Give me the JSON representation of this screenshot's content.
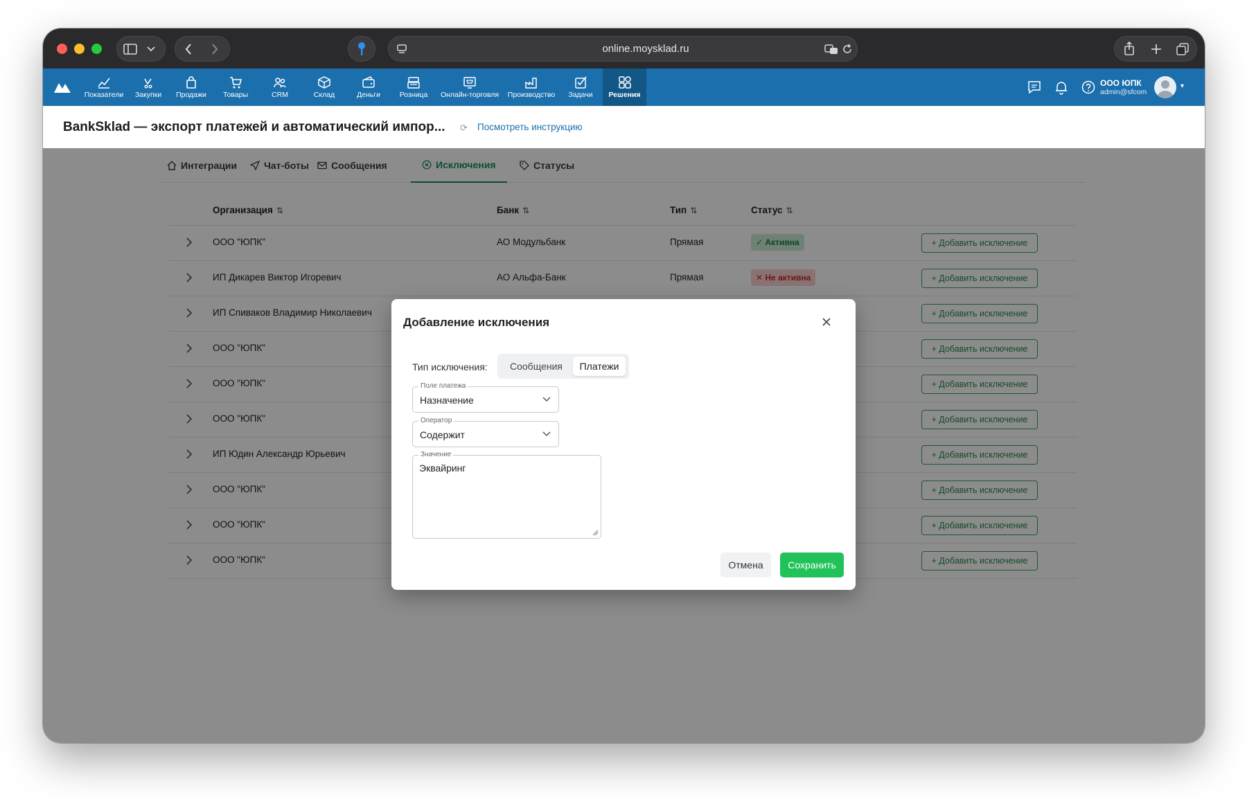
{
  "browser": {
    "url": "online.moysklad.ru"
  },
  "nav": {
    "items": [
      {
        "label": "Показатели",
        "icon": "chart-line-icon"
      },
      {
        "label": "Закупки",
        "icon": "bag-icon"
      },
      {
        "label": "Продажи",
        "icon": "shopping-bag-icon"
      },
      {
        "label": "Товары",
        "icon": "cart-icon"
      },
      {
        "label": "CRM",
        "icon": "people-icon"
      },
      {
        "label": "Склад",
        "icon": "box-icon"
      },
      {
        "label": "Деньги",
        "icon": "wallet-icon"
      },
      {
        "label": "Розница",
        "icon": "cash-register-icon"
      },
      {
        "label": "Онлайн-торговля",
        "icon": "online-store-icon"
      },
      {
        "label": "Производство",
        "icon": "factory-icon"
      },
      {
        "label": "Задачи",
        "icon": "checkbox-icon"
      },
      {
        "label": "Решения",
        "icon": "grid-icon"
      }
    ],
    "active": "Решения",
    "org_name": "ООО ЮПК",
    "org_email": "admin@sfcom"
  },
  "page": {
    "title": "BankSklad — экспорт платежей и автоматический импор...",
    "instruction_link": "Посмотреть инструкцию"
  },
  "tabs": [
    {
      "label": "Интеграции",
      "icon": "home-icon"
    },
    {
      "label": "Чат-боты",
      "icon": "send-icon"
    },
    {
      "label": "Сообщения",
      "icon": "envelope-icon"
    },
    {
      "label": "Исключения",
      "icon": "circle-x-icon"
    },
    {
      "label": "Статусы",
      "icon": "tag-icon"
    }
  ],
  "active_tab": "Исключения",
  "table": {
    "columns": {
      "org": "Организация",
      "bank": "Банк",
      "type": "Тип",
      "status": "Статус",
      "sort_glyph": "⇅"
    },
    "add_button_label": "+ Добавить исключение",
    "rows": [
      {
        "org": "ООО \"ЮПК\"",
        "bank": "АО Модульбанк",
        "type": "Прямая",
        "status": "✓ Активна",
        "status_kind": "active"
      },
      {
        "org": "ИП Дикарев Виктор Игоревич",
        "bank": "АО Альфа-Банк",
        "type": "Прямая",
        "status": "✕ Не активна",
        "status_kind": "inactive"
      },
      {
        "org": "ИП Спиваков Владимир Николаевич"
      },
      {
        "org": "ООО \"ЮПК\""
      },
      {
        "org": "ООО \"ЮПК\""
      },
      {
        "org": "ООО \"ЮПК\""
      },
      {
        "org": "ИП Юдин Александр Юрьевич"
      },
      {
        "org": "ООО \"ЮПК\""
      },
      {
        "org": "ООО \"ЮПК\""
      },
      {
        "org": "ООО \"ЮПК\""
      }
    ]
  },
  "modal": {
    "title": "Добавление исключения",
    "type_label": "Тип исключения:",
    "type_options": [
      "Сообщения",
      "Платежи"
    ],
    "type_selected": "Платежи",
    "field_payment": {
      "label": "Поле платежа",
      "value": "Назначение"
    },
    "field_operator": {
      "label": "Оператор",
      "value": "Содержит"
    },
    "field_value": {
      "label": "Значение",
      "value": "Эквайринг"
    },
    "cancel_label": "Отмена",
    "save_label": "Сохранить"
  },
  "colors": {
    "nav_bg": "#1b6fad",
    "nav_active": "#135786",
    "accent_green": "#22c25a",
    "tab_active": "#1a8c55"
  }
}
